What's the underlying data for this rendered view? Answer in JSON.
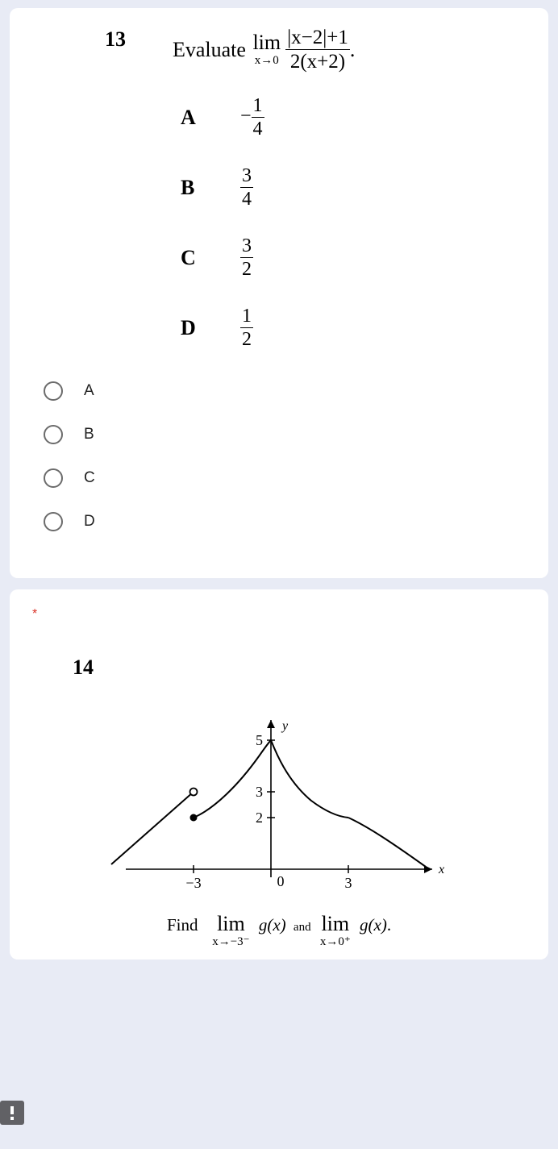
{
  "q13": {
    "number": "13",
    "prompt_word": "Evaluate",
    "lim_label": "lim",
    "lim_sub": "x→0",
    "numerator": "|x−2|+1",
    "denominator": "2(x+2)",
    "period": ".",
    "options": {
      "A": {
        "letter": "A",
        "sign": "−",
        "num": "1",
        "den": "4"
      },
      "B": {
        "letter": "B",
        "sign": "",
        "num": "3",
        "den": "4"
      },
      "C": {
        "letter": "C",
        "sign": "",
        "num": "3",
        "den": "2"
      },
      "D": {
        "letter": "D",
        "sign": "",
        "num": "1",
        "den": "2"
      }
    },
    "radios": {
      "A": "A",
      "B": "B",
      "C": "C",
      "D": "D"
    }
  },
  "q14": {
    "required_marker": "*",
    "number": "14",
    "find_word": "Find",
    "lim_label_1": "lim",
    "lim_sub_1": "x→−3⁻",
    "func_1": "g(x)",
    "and_word": "and",
    "lim_label_2": "lim",
    "lim_sub_2": "x→0⁺",
    "func_2": "g(x)",
    "period": "."
  },
  "chart_data": {
    "type": "line",
    "title": "",
    "xlabel": "x",
    "ylabel": "y",
    "xlim": [
      -6,
      7
    ],
    "ylim": [
      0,
      6
    ],
    "x_ticks": [
      -3,
      0,
      3
    ],
    "y_ticks": [
      2,
      3,
      5
    ],
    "x_tick_labels": [
      "−3",
      "0",
      "3"
    ],
    "y_tick_labels": [
      "2",
      "3",
      "5"
    ],
    "series": [
      {
        "name": "left-branch",
        "description": "straight line from lower-left rising to open circle at (-3,3)",
        "points": [
          [
            -6.2,
            0.2
          ],
          [
            -3,
            3
          ]
        ],
        "end_marker": {
          "x": -3,
          "y": 3,
          "type": "open"
        }
      },
      {
        "name": "middle-left-branch",
        "description": "curve from filled point (-3,2) rising to y-axis approaching 5",
        "points": [
          [
            -3,
            2
          ],
          [
            -2.2,
            2.6
          ],
          [
            -1.3,
            3.5
          ],
          [
            -0.5,
            4.4
          ],
          [
            0,
            5
          ]
        ],
        "start_marker": {
          "x": -3,
          "y": 2,
          "type": "closed"
        }
      },
      {
        "name": "middle-right-branch",
        "description": "curve from (0,5) descending to about (3,2)",
        "points": [
          [
            0,
            5
          ],
          [
            0.6,
            3.6
          ],
          [
            1.4,
            2.9
          ],
          [
            2.2,
            2.3
          ],
          [
            3,
            2
          ]
        ]
      },
      {
        "name": "right-branch",
        "description": "curve from (3,2) descending to x-axis near x≈6",
        "points": [
          [
            3,
            2
          ],
          [
            4,
            1.6
          ],
          [
            5,
            1.0
          ],
          [
            6.2,
            0.1
          ]
        ]
      }
    ]
  }
}
